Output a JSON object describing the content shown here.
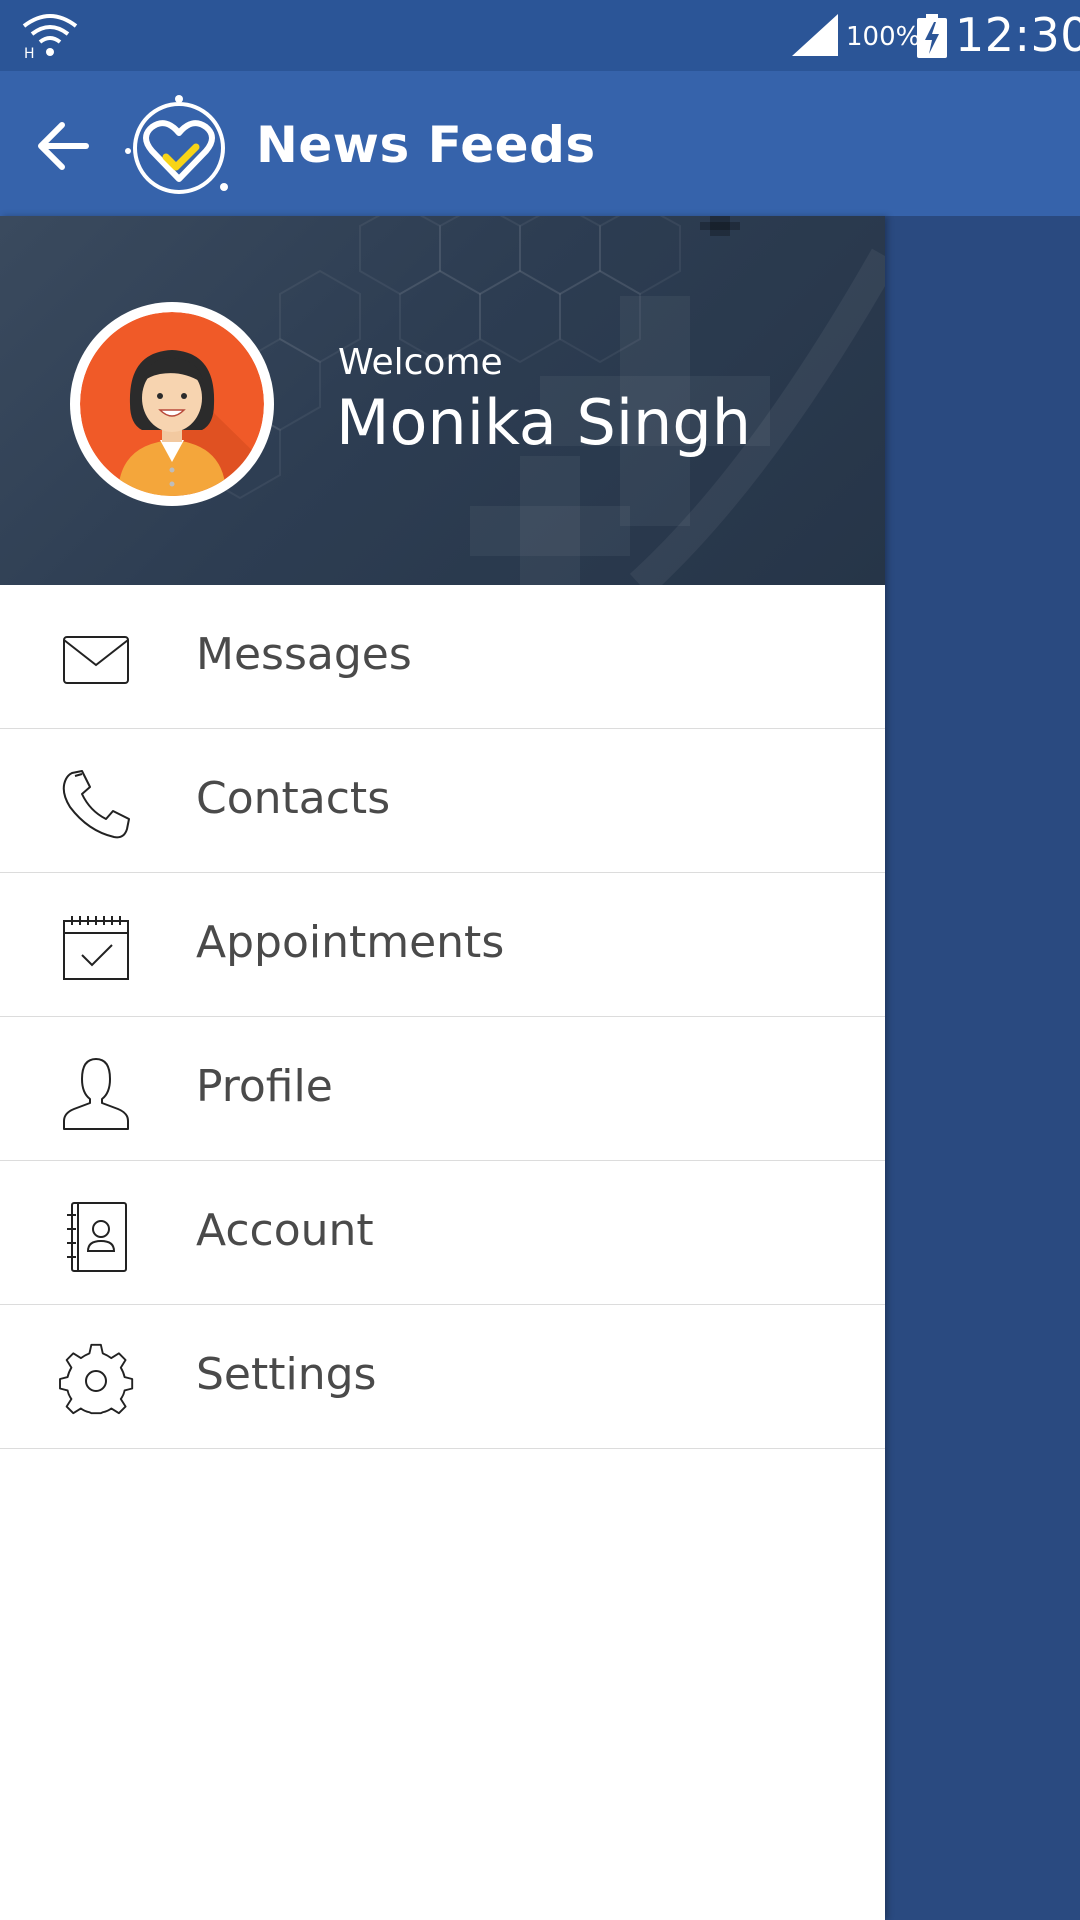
{
  "status_bar": {
    "battery_percent": "100%",
    "time": "12:30",
    "network_type": "H"
  },
  "app_bar": {
    "title": "News Feeds"
  },
  "drawer": {
    "welcome": "Welcome",
    "user_name": "Monika Singh",
    "items": [
      {
        "label": "Messages",
        "icon": "envelope-icon"
      },
      {
        "label": "Contacts",
        "icon": "phone-icon"
      },
      {
        "label": "Appointments",
        "icon": "calendar-check-icon"
      },
      {
        "label": "Profile",
        "icon": "user-icon"
      },
      {
        "label": "Account",
        "icon": "address-book-icon"
      },
      {
        "label": "Settings",
        "icon": "gear-icon"
      }
    ]
  },
  "colors": {
    "status_bar": "#2b5597",
    "app_bar": "#3663ab",
    "scrim": "#2a4a80",
    "drawer_header": "#2d3d52",
    "avatar_bg": "#f05a28",
    "menu_text": "#4a4a4a",
    "logo_check": "#f7d417"
  }
}
